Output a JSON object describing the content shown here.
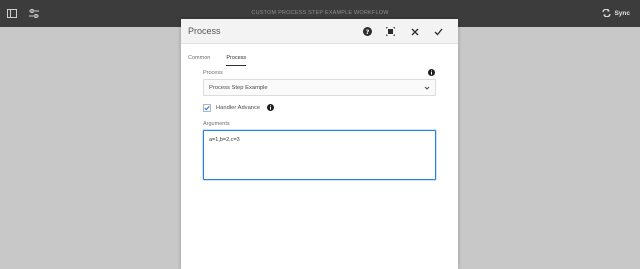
{
  "topbar": {
    "title": "CUSTOM PROCESS STEP EXAMPLE WORKFLOW",
    "sync_label": "Sync",
    "icons": [
      "sidebar-toggle-icon",
      "sliders-icon",
      "sync-icon"
    ]
  },
  "dialog": {
    "title": "Process",
    "header_icons": [
      "help-icon",
      "fullscreen-icon",
      "close-icon",
      "confirm-icon"
    ],
    "tabs": [
      {
        "label": "Common",
        "active": false
      },
      {
        "label": "Process",
        "active": true
      }
    ],
    "process_field": {
      "label": "Process",
      "value": "Process Step Example"
    },
    "handler_advance": {
      "label": "Handler Advance",
      "checked": true
    },
    "arguments_field": {
      "label": "Arguments",
      "value": "a=1,b=2,c=3"
    }
  },
  "colors": {
    "topbar_bg": "#3c3c3c",
    "backdrop": "#c8c8c8",
    "accent": "#2680eb",
    "checkbox_check": "#2680eb"
  }
}
